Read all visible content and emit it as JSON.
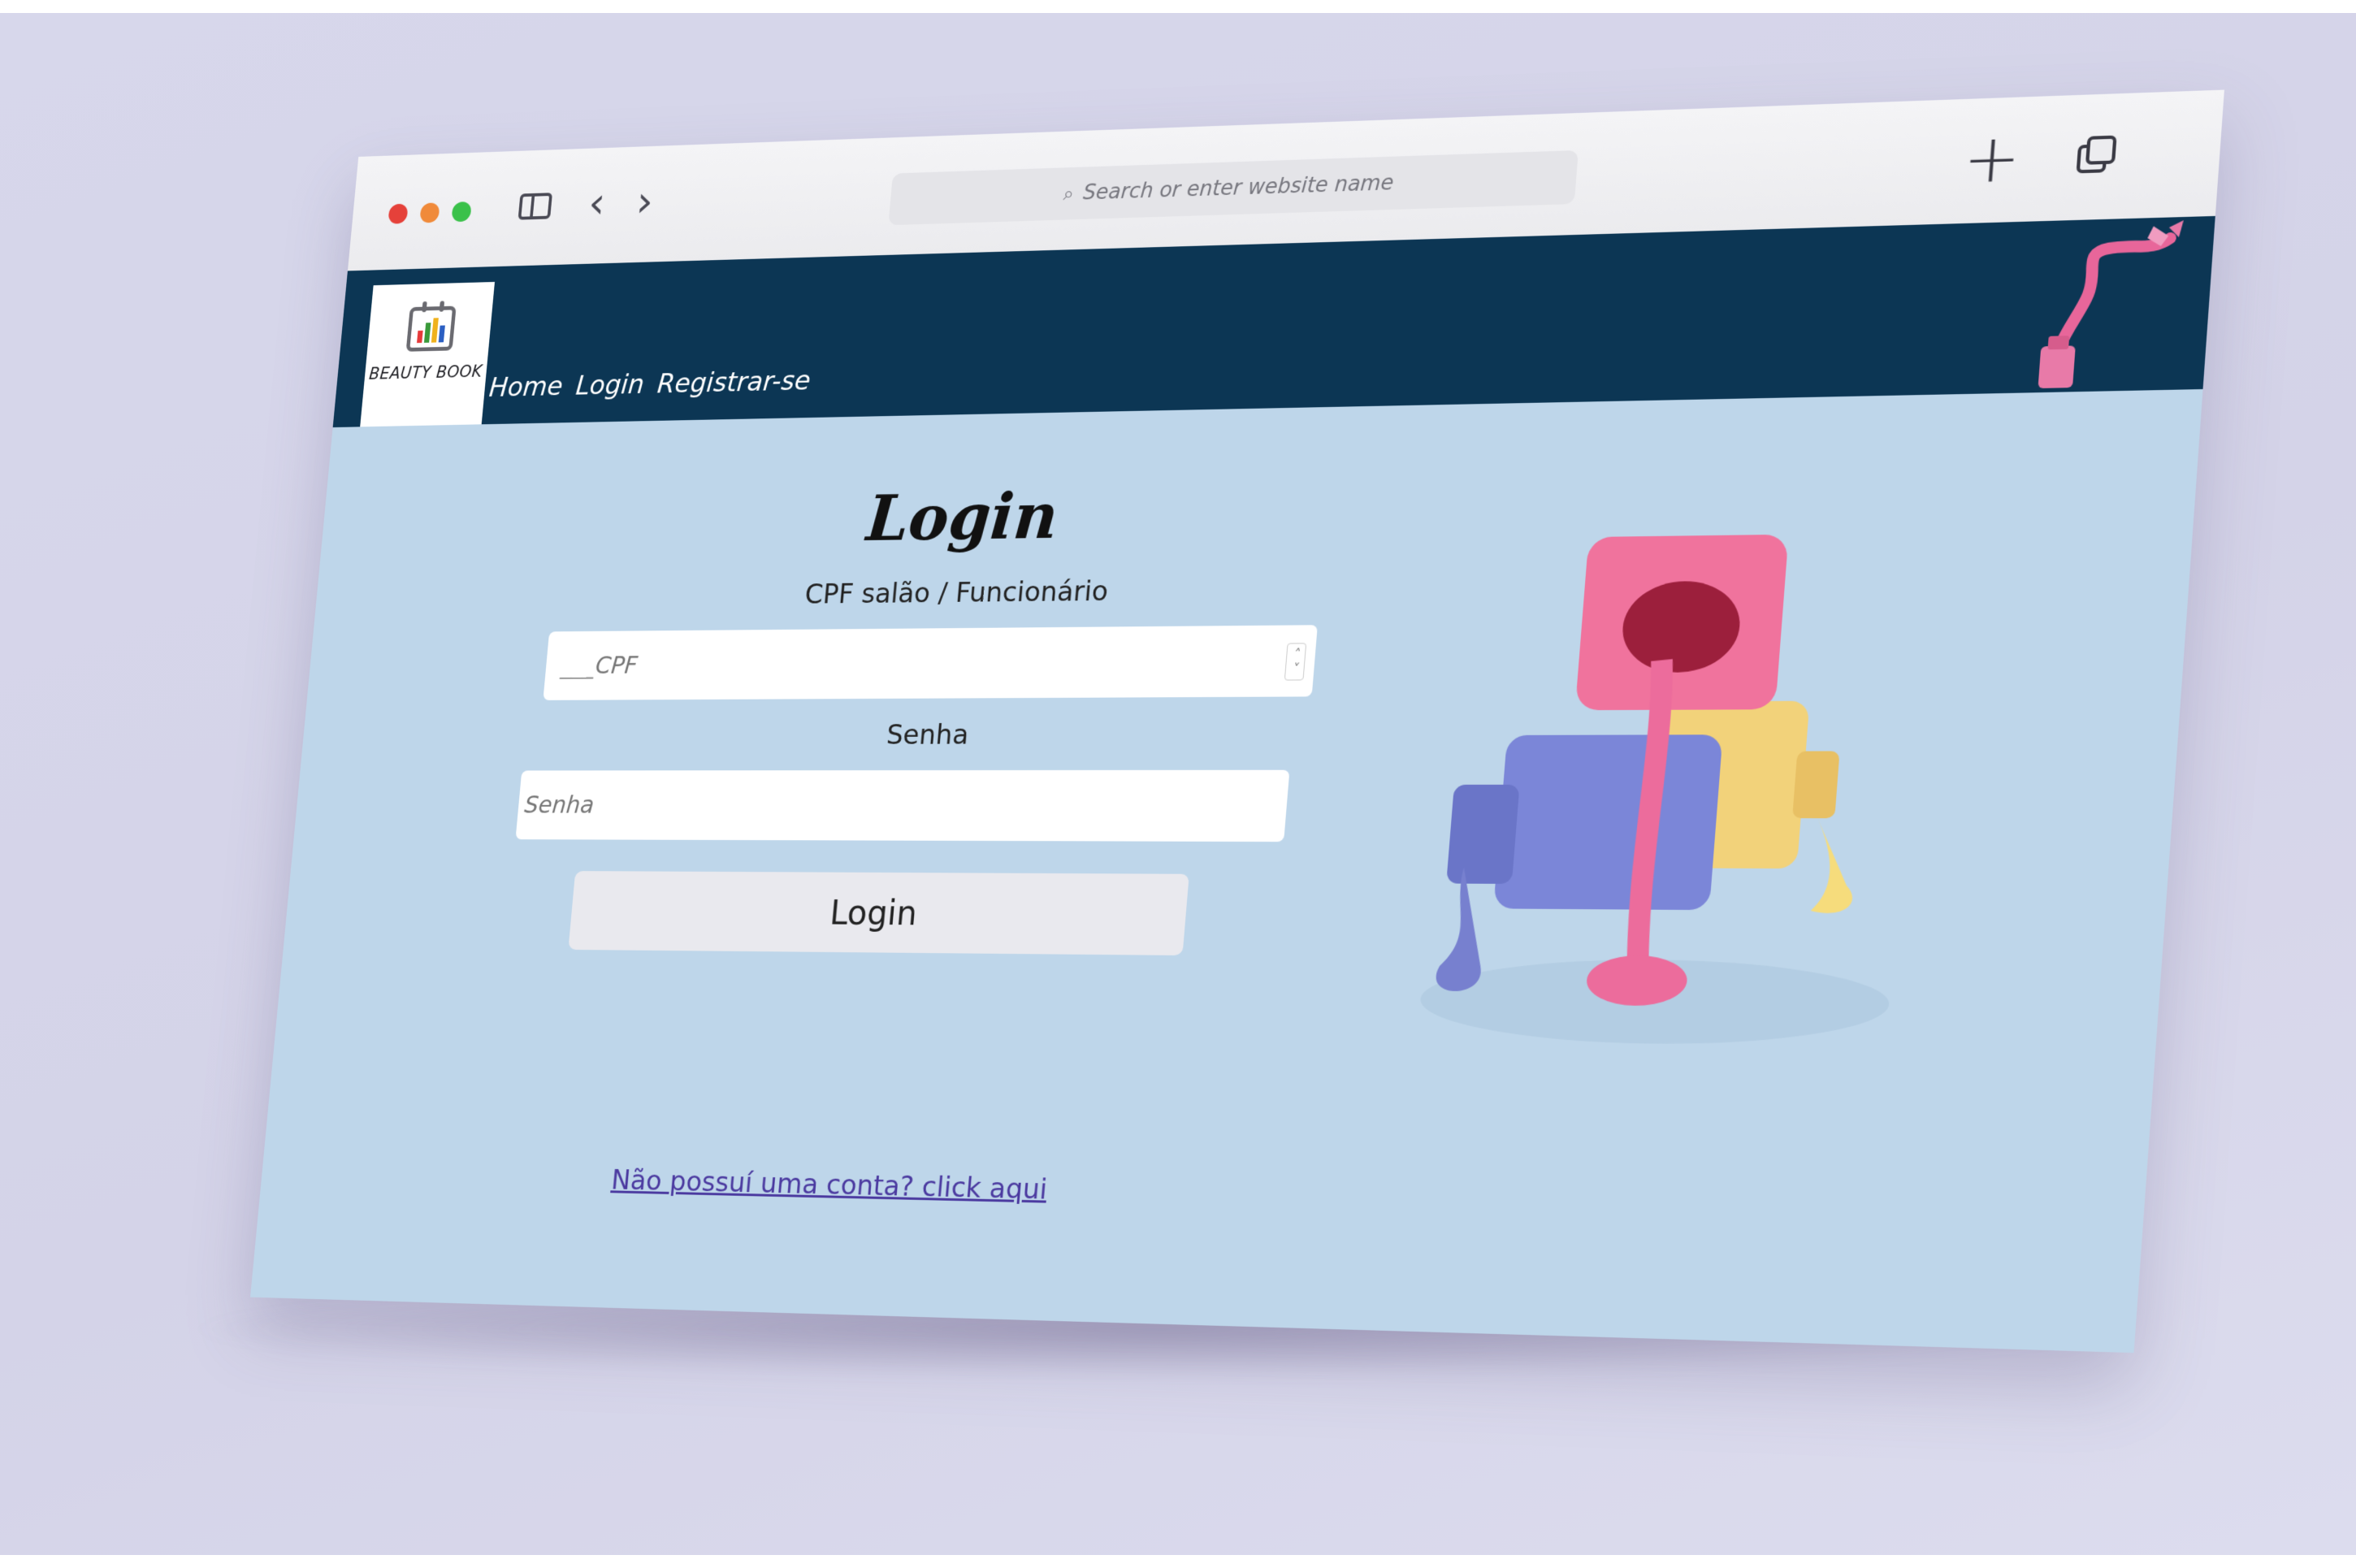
{
  "browser": {
    "address_placeholder": "Search or enter website name"
  },
  "site": {
    "logo_text": "BEAUTY BOOK",
    "nav": [
      "Home",
      "Login",
      "Registrar-se"
    ]
  },
  "form": {
    "title": "Login",
    "cpf_label": "CPF salão / Funcionário",
    "cpf_mask": "___",
    "cpf_placeholder": "CPF",
    "senha_label": "Senha",
    "senha_placeholder": "Senha",
    "submit_label": "Login",
    "register_link": "Não possuí uma conta? click aqui"
  },
  "colors": {
    "header_bg": "#0c3654",
    "page_bg": "#bed6ea",
    "link": "#4b3aa0"
  }
}
